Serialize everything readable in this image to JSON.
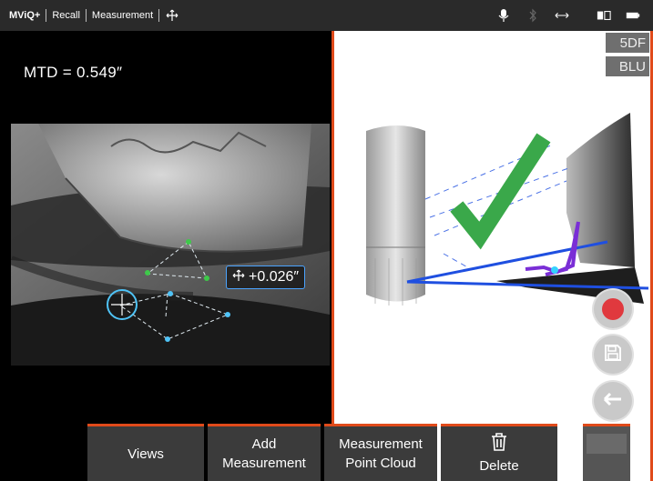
{
  "topbar": {
    "brand": "MViQ+",
    "crumbs": [
      "Recall",
      "Measurement"
    ],
    "icons": [
      "move-icon",
      "microphone-icon",
      "bluetooth-icon",
      "network-icon",
      "split-view-icon",
      "battery-icon"
    ]
  },
  "left_pane": {
    "mtd": "MTD = 0.549″",
    "measurement_value": "+0.026″"
  },
  "right_pane": {
    "badges": [
      "5DF",
      "BLU"
    ],
    "check_color": "#3aa84a",
    "line_color": "#1f4fe0"
  },
  "side_buttons": [
    "record-button",
    "save-button",
    "back-button"
  ],
  "softkeys": {
    "views": "Views",
    "add_line1": "Add",
    "add_line2": "Measurement",
    "mpc_line1": "Measurement",
    "mpc_line2": "Point Cloud",
    "delete": "Delete"
  },
  "colors": {
    "accent": "#e04a1a",
    "measure_blue": "#4aa3ff"
  }
}
